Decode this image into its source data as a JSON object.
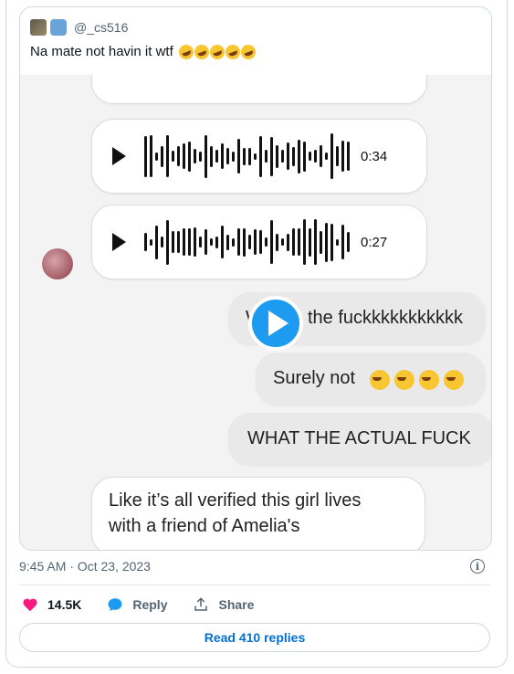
{
  "quoted_tweet": {
    "handle": "@_cs516",
    "text": "Na mate not havin it wtf"
  },
  "media": {
    "voice_notes": [
      {
        "duration": "0:34"
      },
      {
        "duration": "0:27"
      }
    ],
    "messages": [
      {
        "text": "the fuckkkkkkkkkkk",
        "visible_prefix": "W"
      },
      {
        "text": "Surely not"
      },
      {
        "text": "WHAT THE ACTUAL FUCK"
      },
      {
        "text_line1": "Like it’s all verified this girl lives",
        "text_line2": "with a friend of Amelia's"
      }
    ]
  },
  "timestamp": "9:45 AM · Oct 23, 2023",
  "actions": {
    "like_count": "14.5K",
    "reply_label": "Reply",
    "share_label": "Share"
  },
  "read_replies_label": "Read 410 replies",
  "colors": {
    "like": "#f91880",
    "reply": "#1d9bf0",
    "link": "#006fd6",
    "play": "#1d9bf0"
  }
}
